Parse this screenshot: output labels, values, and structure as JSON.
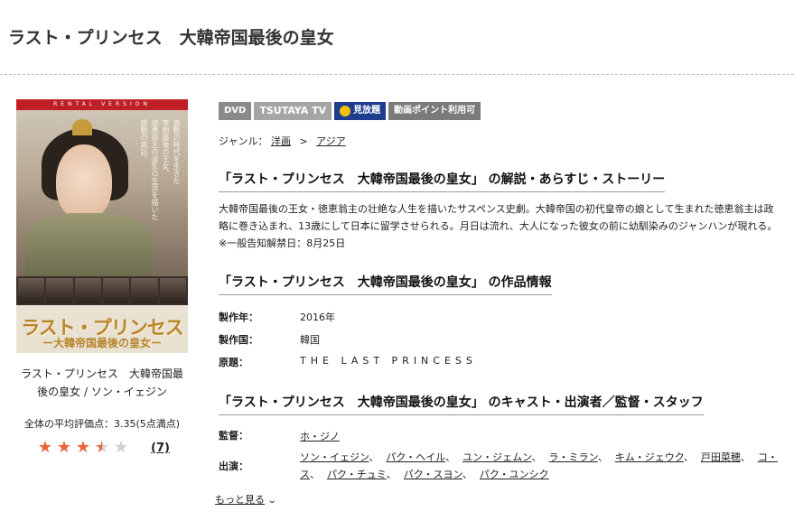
{
  "page": {
    "title": "ラスト・プリンセス　大韓帝国最後の皇女"
  },
  "cover": {
    "band_text": "RENTAL VERSION",
    "logo_line1": "ラスト・プリンセス",
    "logo_line2": "ー大韓帝国最後の皇女ー",
    "vertical_text_1": "激動の時代を生きた",
    "vertical_text_2": "李朝最後の王女、",
    "vertical_text_3": "徳恵翁主の波乱の生涯を描いた",
    "vertical_text_4": "感動の実話。"
  },
  "sidebar": {
    "title": "ラスト・プリンセス　大韓帝国最後の皇女 / ソン・イェジン",
    "avg_rating_label": "全体の平均評価点：3.35(5点満点)",
    "rating_value": 3.35,
    "rating_max": 5,
    "review_count": "(7)"
  },
  "badges": [
    {
      "label": "DVD"
    },
    {
      "label": "TSUTAYA TV"
    },
    {
      "label": "見放題"
    },
    {
      "label": "動画ポイント利用可"
    }
  ],
  "genre": {
    "label": "ジャンル：",
    "items": [
      "洋画",
      "アジア"
    ],
    "separator": ">"
  },
  "sections": {
    "story_heading": "「ラスト・プリンセス　大韓帝国最後の皇女」 の解説・あらすじ・ストーリー",
    "story_text": "大韓帝国最後の王女・徳恵翁主の壮絶な人生を描いたサスペンス史劇。大韓帝国の初代皇帝の娘として生まれた徳恵翁主は政略に巻き込まれ、13歳にして日本に留学させられる。月日は流れ、大人になった彼女の前に幼馴染みのジャンハンが現れる。※一般告知解禁日：8月25日",
    "info_heading": "「ラスト・プリンセス　大韓帝国最後の皇女」 の作品情報",
    "cast_heading": "「ラスト・プリンセス　大韓帝国最後の皇女」 のキャスト・出演者／監督・スタッフ"
  },
  "info": [
    {
      "label": "製作年：",
      "value": "2016年"
    },
    {
      "label": "製作国：",
      "value": "韓国"
    },
    {
      "label": "原題：",
      "value": "THE LAST PRINCESS"
    }
  ],
  "staff": {
    "director_label": "監督：",
    "director": "ホ・ジノ",
    "cast_label": "出演：",
    "cast": [
      "ソン・イェジン",
      "パク・ヘイル",
      "ユン・ジェムン",
      "ラ・ミラン",
      "キム・ジェウク",
      "戸田菜穂",
      "コ・ス",
      "パク・チュミ",
      "パク・スヨン",
      "パク・ユンシク"
    ],
    "separator": "、"
  },
  "more_link": "もっと見る"
}
